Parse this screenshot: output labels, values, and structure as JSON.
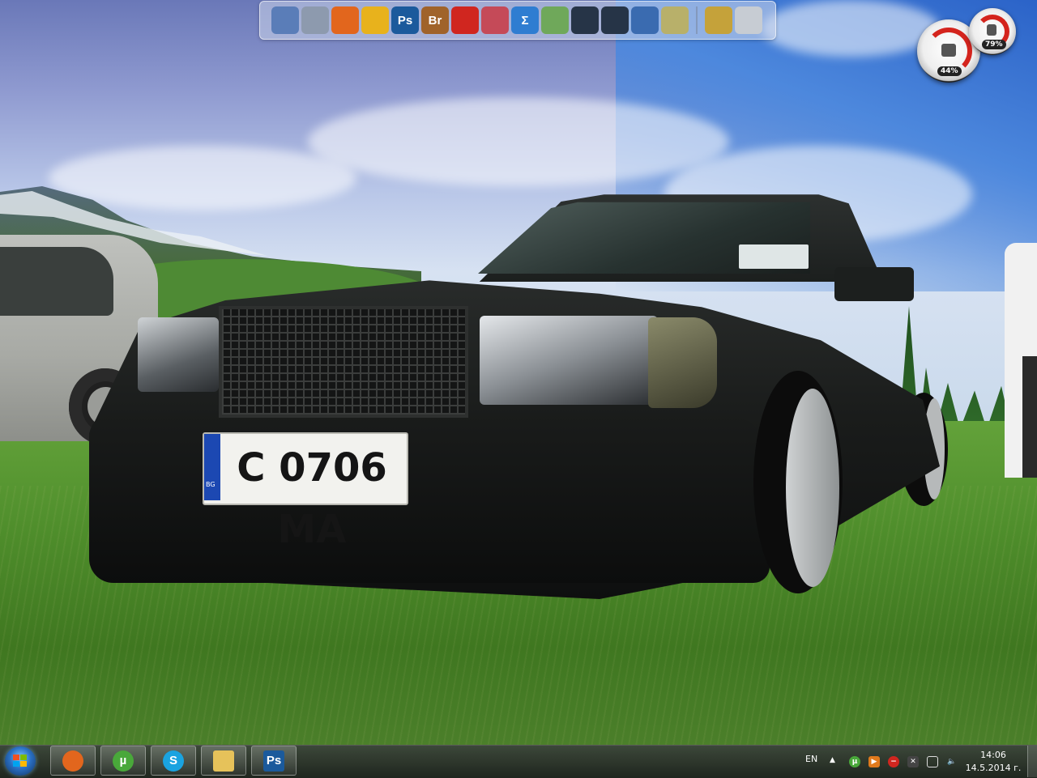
{
  "wallpaper": {
    "plate_text": "C 0706 MA",
    "plate_country": "BG"
  },
  "dock": {
    "icons": [
      {
        "name": "computer-icon",
        "label": "",
        "color": "#5a7db8"
      },
      {
        "name": "folders-icon",
        "label": "",
        "color": "#8d9aae"
      },
      {
        "name": "firefox-icon",
        "label": "",
        "color": "#e2661d"
      },
      {
        "name": "aimp-icon",
        "label": "",
        "color": "#e8b21c"
      },
      {
        "name": "photoshop-icon",
        "label": "Ps",
        "color": "#1b5a9c"
      },
      {
        "name": "bridge-icon",
        "label": "Br",
        "color": "#a0632a"
      },
      {
        "name": "acrobat-icon",
        "label": "",
        "color": "#d0261f"
      },
      {
        "name": "mathtype-icon",
        "label": "",
        "color": "#c54a58"
      },
      {
        "name": "sigma-icon",
        "label": "Σ",
        "color": "#2f7dd1"
      },
      {
        "name": "maps-icon",
        "label": "",
        "color": "#6fa85a"
      },
      {
        "name": "app-b1-icon",
        "label": "",
        "color": "#263447"
      },
      {
        "name": "app-b2-icon",
        "label": "",
        "color": "#263447"
      },
      {
        "name": "webcam-icon",
        "label": "",
        "color": "#3a6bb0"
      },
      {
        "name": "documents-icon",
        "label": "",
        "color": "#b8b06a"
      }
    ],
    "icons_after_separator": [
      {
        "name": "tools-icon",
        "label": "",
        "color": "#c5a23a"
      },
      {
        "name": "recycle-bin-icon",
        "label": "",
        "color": "#c7ccd3"
      }
    ]
  },
  "gadgets": {
    "cpu_label": "44%",
    "memory_label": "79%",
    "accent_color": "#d4241d"
  },
  "taskbar": {
    "buttons": [
      {
        "name": "firefox-taskbar-button",
        "icon": "firefox-icon",
        "label": "",
        "color": "#e2661d"
      },
      {
        "name": "utorrent-taskbar-button",
        "icon": "utorrent-icon",
        "label": "µ",
        "color": "#49a83a"
      },
      {
        "name": "skype-taskbar-button",
        "icon": "skype-icon",
        "label": "S",
        "color": "#1aa3e0"
      },
      {
        "name": "explorer-taskbar-button",
        "icon": "folder-icon",
        "label": "",
        "color": "#e6c25a"
      },
      {
        "name": "photoshop-taskbar-button",
        "icon": "photoshop-icon",
        "label": "Ps",
        "color": "#1b5a9c"
      }
    ],
    "language": "EN",
    "clock_time": "14:06",
    "clock_date": "14.5.2014 г."
  }
}
